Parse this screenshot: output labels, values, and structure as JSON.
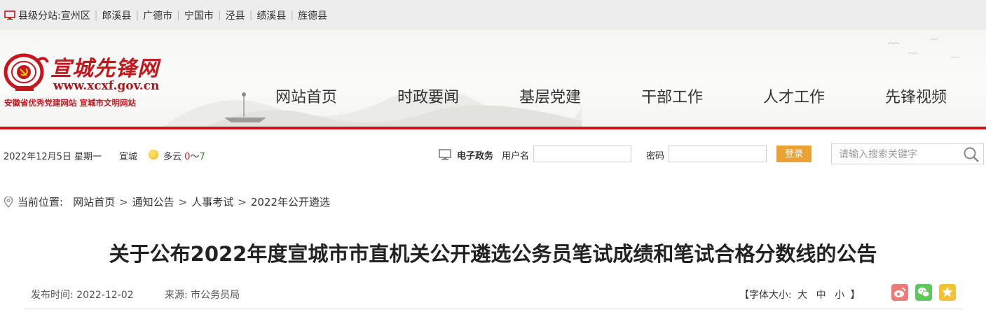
{
  "topbar": {
    "label": "县级分站:",
    "counties": [
      "宣州区",
      "郎溪县",
      "广德市",
      "宁国市",
      "泾县",
      "绩溪县",
      "旌德县"
    ]
  },
  "header": {
    "logo_title": "宣城先锋网",
    "logo_url": "www.xcxf.gov.cn",
    "logo_slogan": "安徽省优秀党建网站  宣城市文明网站",
    "nav": [
      "网站首页",
      "时政要闻",
      "基层党建",
      "干部工作",
      "人才工作",
      "先锋视频"
    ]
  },
  "infobar": {
    "date": "2022年12月5日 星期一",
    "city": "宣城",
    "weather_text": "多云 ",
    "temp_low": "0",
    "temp_sep": "～",
    "temp_high": "7",
    "egov_label": "电子政务",
    "username_label": "用户名",
    "password_label": "密码",
    "login_label": "登录",
    "search_placeholder": "请输入搜索关键字"
  },
  "breadcrumb": {
    "label": "当前位置:",
    "items": [
      "网站首页",
      "通知公告",
      "人事考试",
      "2022年公开遴选"
    ]
  },
  "article": {
    "title": "关于公布2022年度宣城市市直机关公开遴选公务员笔试成绩和笔试合格分数线的公告",
    "publish_label": "发布时间:",
    "publish_date": "2022-12-02",
    "source_label": "来源:",
    "source": "市公务员局",
    "fontsize_open": "【字体大小:",
    "fontsize_large": "大",
    "fontsize_medium": "中",
    "fontsize_small": "小",
    "fontsize_close": "】"
  },
  "colors": {
    "brand_red": "#c8141c",
    "login_orange": "#e9a233",
    "weibo": "#f07a7a",
    "wechat": "#5ec85e",
    "favorite": "#f2c230"
  },
  "icons": [
    "monitor-icon",
    "party-emblem-icon",
    "sun-icon",
    "computer-icon",
    "search-icon",
    "location-pin-icon",
    "weibo-icon",
    "wechat-icon",
    "star-icon"
  ]
}
